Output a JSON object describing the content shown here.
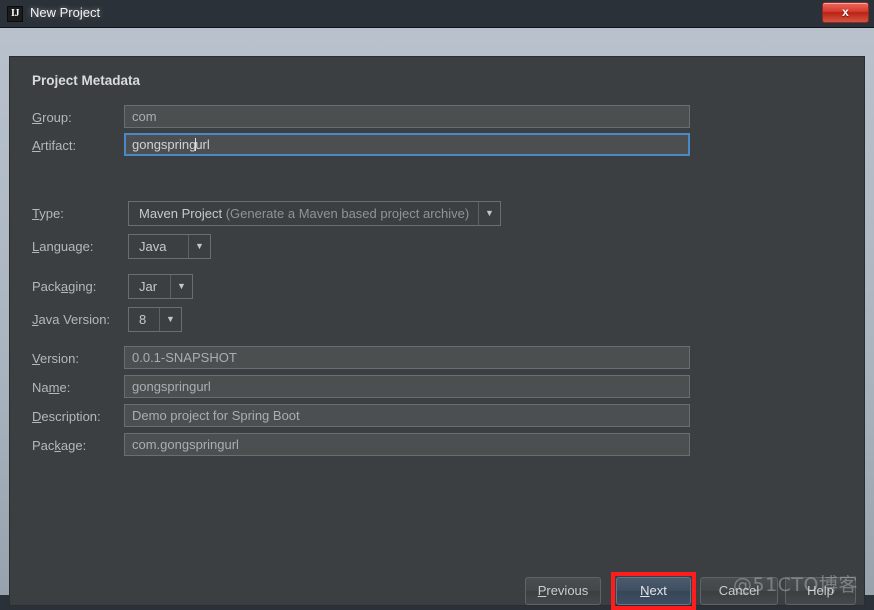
{
  "window": {
    "title": "New Project",
    "icon": "intellij-idea-icon",
    "icon_text": "IJ",
    "close_label": "x"
  },
  "dialog": {
    "heading": "Project Metadata"
  },
  "fields": {
    "group": {
      "label_pre": "",
      "label_mnemonic": "G",
      "label_post": "roup:",
      "value": "com"
    },
    "artifact": {
      "label_pre": "",
      "label_mnemonic": "A",
      "label_post": "rtifact:",
      "value_before_caret": "gongspring",
      "value_after_caret": "url",
      "focused": true
    },
    "type": {
      "label_pre": "",
      "label_mnemonic": "T",
      "label_post": "ype:",
      "value_main": "Maven Project",
      "value_detail": "(Generate a Maven based project archive)"
    },
    "language": {
      "label_pre": "",
      "label_mnemonic": "L",
      "label_post": "anguage:",
      "value": "Java"
    },
    "packaging": {
      "label_pre": "Pack",
      "label_mnemonic": "a",
      "label_post": "ging:",
      "value": "Jar"
    },
    "java_version": {
      "label_pre": "",
      "label_mnemonic": "J",
      "label_post": "ava Version:",
      "value": "8"
    },
    "version": {
      "label_pre": "",
      "label_mnemonic": "V",
      "label_post": "ersion:",
      "value": "0.0.1-SNAPSHOT"
    },
    "name": {
      "label_pre": "Na",
      "label_mnemonic": "m",
      "label_post": "e:",
      "value": "gongspringurl"
    },
    "description": {
      "label_pre": "",
      "label_mnemonic": "D",
      "label_post": "escription:",
      "value": "Demo project for Spring Boot"
    },
    "package": {
      "label_pre": "Pac",
      "label_mnemonic": "k",
      "label_post": "age:",
      "value": "com.gongspringurl"
    }
  },
  "buttons": {
    "previous": {
      "pre": "",
      "mnemonic": "P",
      "post": "revious"
    },
    "next": {
      "pre": "",
      "mnemonic": "N",
      "post": "ext",
      "is_default": true,
      "highlighted": true
    },
    "cancel": {
      "pre": "Cancel",
      "mnemonic": "",
      "post": ""
    },
    "help": {
      "pre": "Help",
      "mnemonic": "",
      "post": ""
    }
  },
  "icons": {
    "dropdown_arrow": "▼"
  },
  "watermark": {
    "text": "@51CTO博客"
  },
  "colors": {
    "panel_bg": "#3C3F41",
    "input_bg": "#4B4F50",
    "focus_border": "#4A88C7",
    "highlight": "#FF1C1C",
    "label_text": "#B4B8BB"
  }
}
